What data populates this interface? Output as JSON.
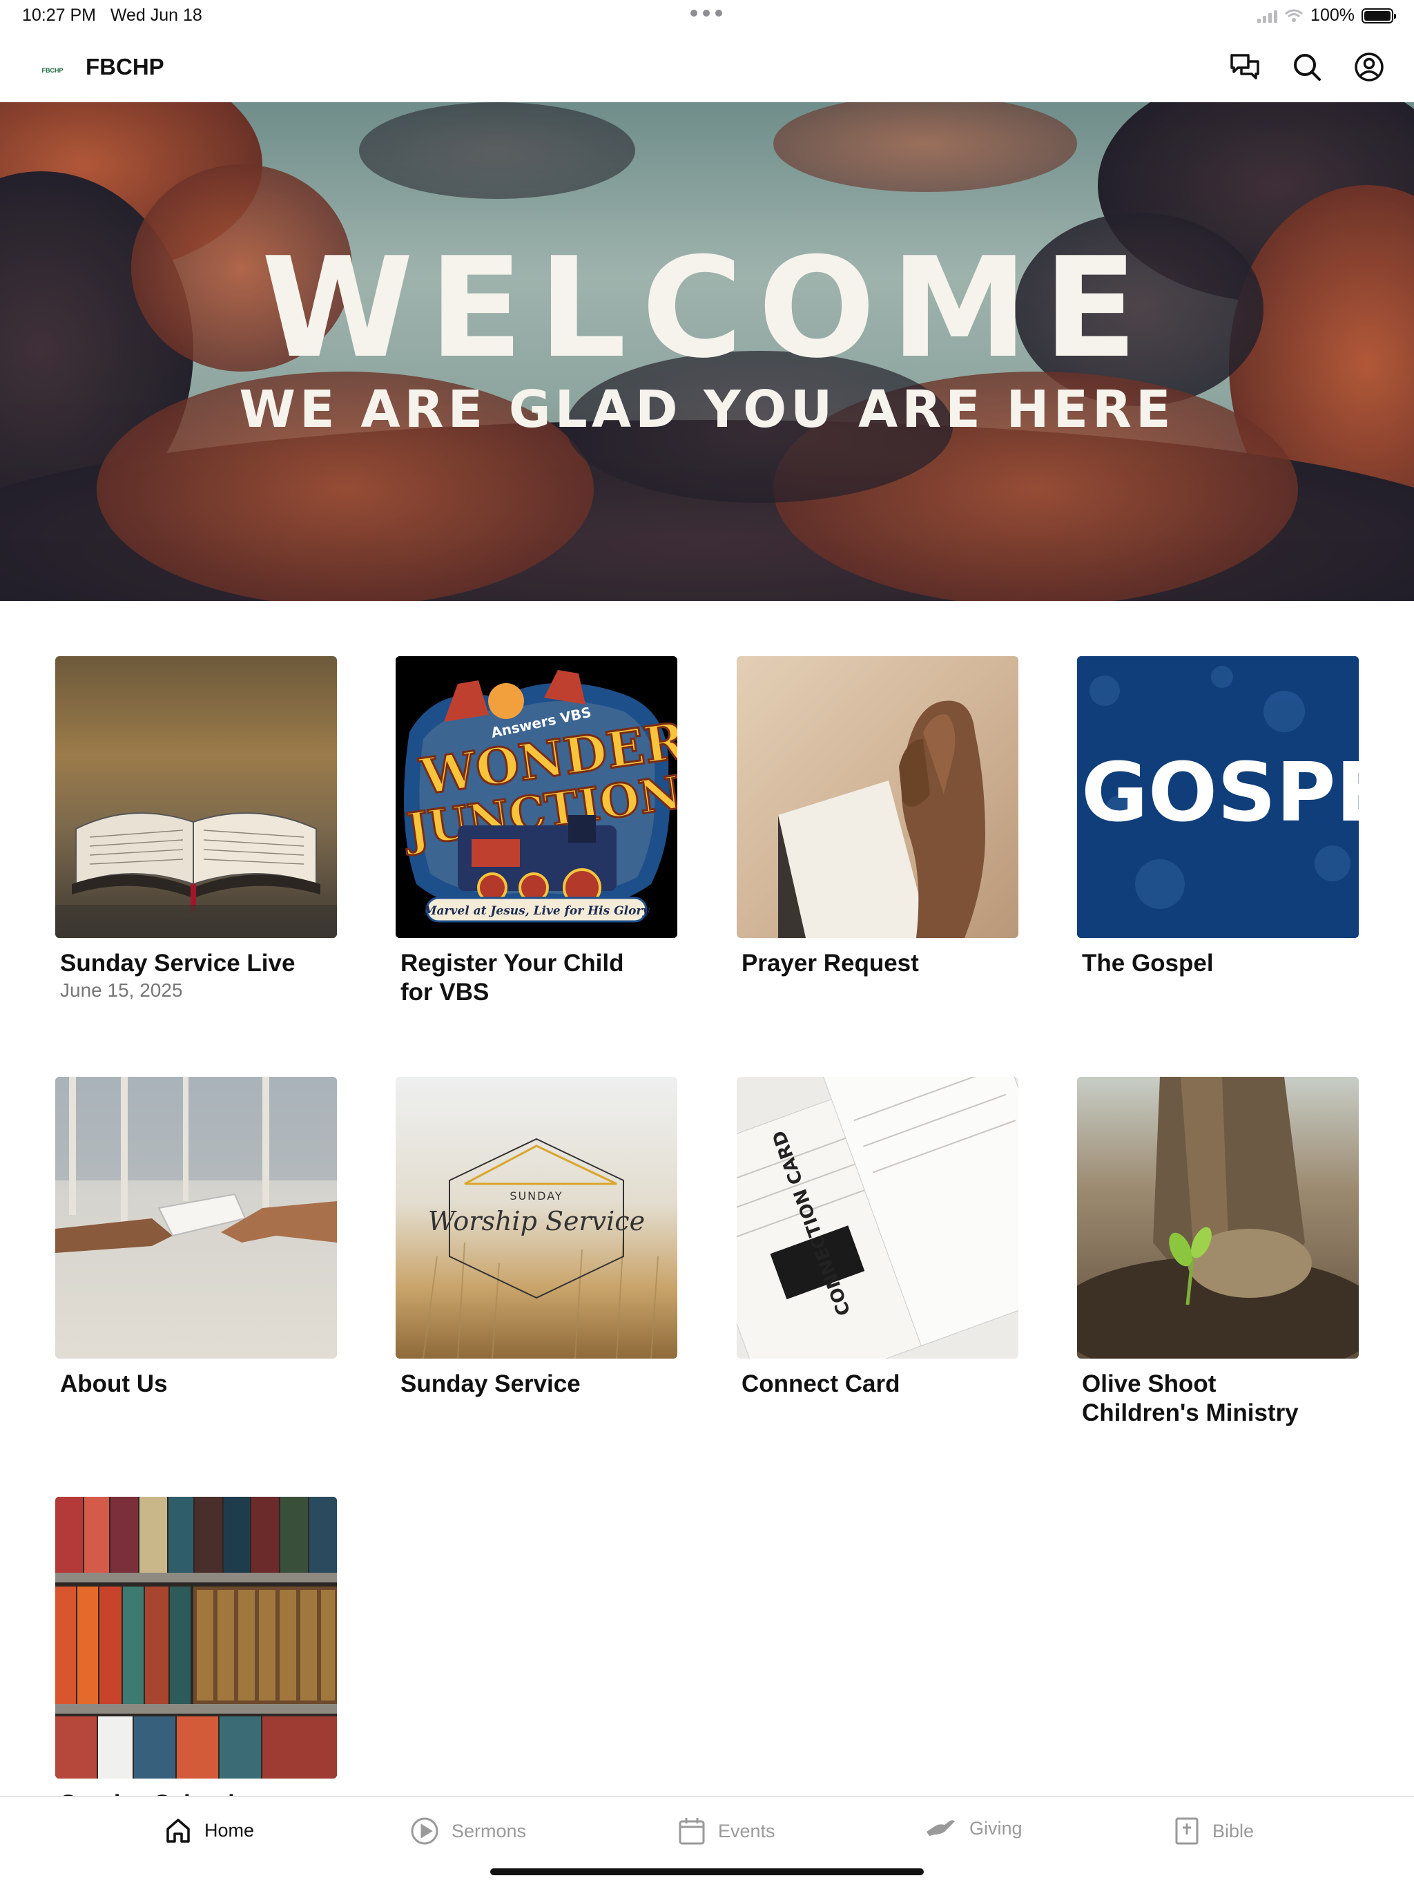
{
  "status_bar": {
    "time": "10:27 PM",
    "date": "Wed Jun 18",
    "battery": "100%",
    "battery_level": 1.0
  },
  "app_bar": {
    "logo_text": "FBCHP",
    "title": "FBCHP",
    "actions": [
      {
        "name": "chat-icon"
      },
      {
        "name": "search-icon"
      },
      {
        "name": "account-icon"
      }
    ]
  },
  "hero": {
    "title": "WELCOME",
    "subtitle": "WE ARE GLAD YOU ARE HERE"
  },
  "tiles": [
    {
      "title": "Sunday Service Live",
      "subtitle": "June 15, 2025",
      "image": "open-bible-photo"
    },
    {
      "title": "Register Your Child for VBS",
      "subtitle": "",
      "image": "wonder-junction-vbs-logo",
      "image_text": {
        "brand": "Answers VBS",
        "line1": "WONDER",
        "line2": "JUNCTION",
        "tagline": "Marvel at Jesus, Live for His Glory"
      }
    },
    {
      "title": "Prayer Request",
      "subtitle": "",
      "image": "praying-hands-photo"
    },
    {
      "title": "The Gospel",
      "subtitle": "",
      "image": "gospel-graphic",
      "image_text": {
        "word": "GOSPEL"
      }
    },
    {
      "title": "About Us",
      "subtitle": "",
      "image": "handing-card-photo"
    },
    {
      "title": "Sunday Service",
      "subtitle": "",
      "image": "worship-service-graphic",
      "image_text": {
        "small": "SUNDAY",
        "script": "Worship Service"
      }
    },
    {
      "title": "Connect Card",
      "subtitle": "",
      "image": "connection-cards-photo",
      "image_text": {
        "label": "CONNECTION CARD"
      }
    },
    {
      "title": "Olive Shoot Children's Ministry",
      "subtitle": "",
      "image": "sprout-photo"
    },
    {
      "title": "Sunday School",
      "subtitle": "",
      "image": "bookshelf-photo"
    }
  ],
  "tab_bar": {
    "tabs": [
      {
        "label": "Home",
        "icon": "home-icon",
        "active": true
      },
      {
        "label": "Sermons",
        "icon": "play-circle-icon",
        "active": false
      },
      {
        "label": "Events",
        "icon": "calendar-icon",
        "active": false
      },
      {
        "label": "Giving",
        "icon": "giving-hand-icon",
        "active": false
      },
      {
        "label": "Bible",
        "icon": "bible-icon",
        "active": false
      }
    ]
  },
  "colors": {
    "gospel_blue": "#0f3e7a",
    "active_tab": "#111111",
    "inactive_tab": "#9a9a9a"
  }
}
